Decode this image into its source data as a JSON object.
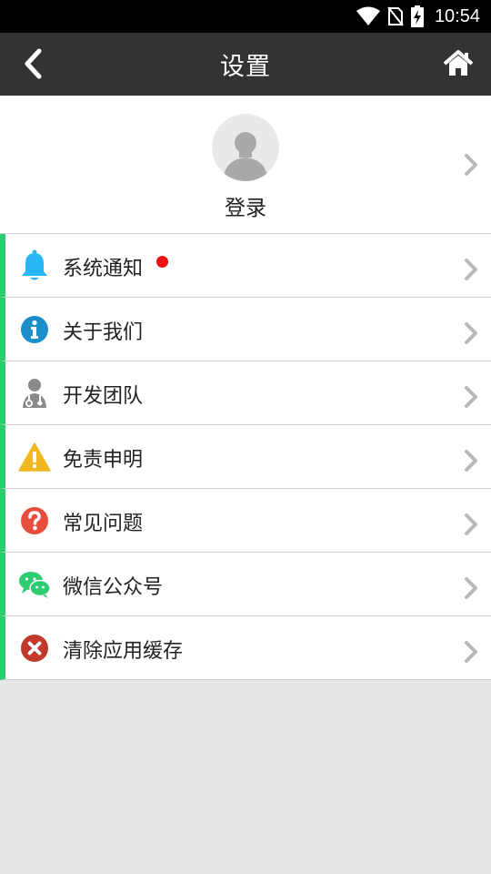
{
  "status_bar": {
    "time": "10:54"
  },
  "header": {
    "title": "设置"
  },
  "profile": {
    "login_label": "登录"
  },
  "menu": [
    {
      "label": "系统通知",
      "icon": "bell-icon",
      "color": "#29b6f6",
      "badge": true
    },
    {
      "label": "关于我们",
      "icon": "info-icon",
      "color": "#1a8fc9"
    },
    {
      "label": "开发团队",
      "icon": "doctor-icon",
      "color": "#8a8a8a"
    },
    {
      "label": "免责申明",
      "icon": "warning-icon",
      "color": "#f0b81f"
    },
    {
      "label": "常见问题",
      "icon": "question-icon",
      "color": "#e74c3c"
    },
    {
      "label": "微信公众号",
      "icon": "wechat-icon",
      "color": "#2ecc71"
    },
    {
      "label": "清除应用缓存",
      "icon": "clear-cache-icon",
      "color": "#c0392b"
    }
  ],
  "colors": {
    "accent": "#2ecc71",
    "app_bar": "#333333",
    "badge": "#ee1111"
  }
}
